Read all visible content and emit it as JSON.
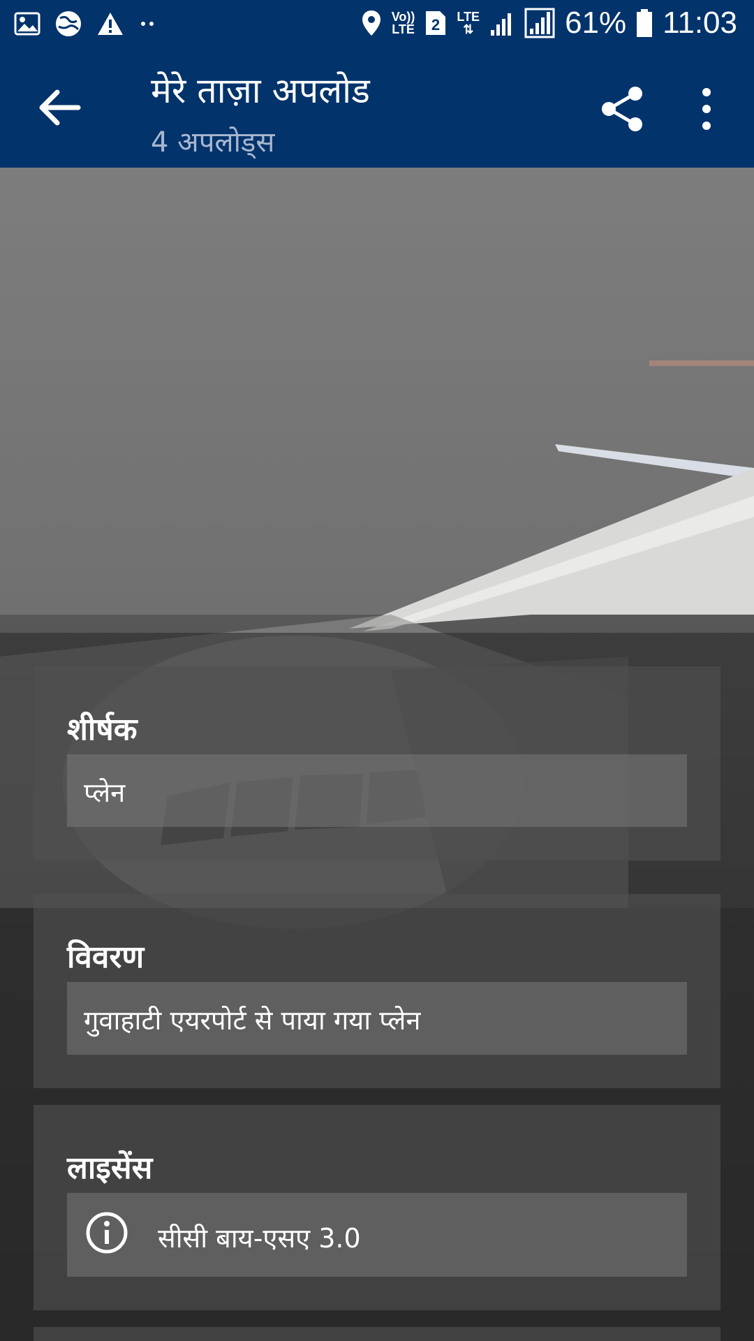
{
  "status_bar": {
    "battery_percent": "61%",
    "time": "11:03",
    "sim_slot": "2",
    "network": "LTE",
    "volte": "Vo)) LTE",
    "icons": [
      "gallery-icon",
      "globe-icon",
      "warning-icon",
      "more-dots-icon",
      "location-icon",
      "volte-icon",
      "sim-2-icon",
      "lte-icon",
      "signal-icon",
      "signal-full-icon",
      "battery-icon"
    ]
  },
  "app_bar": {
    "title": "मेरे ताज़ा अपलोड",
    "subtitle": "4 अपलोड्स",
    "back_icon": "arrow-back-icon",
    "share_icon": "share-icon",
    "more_icon": "more-vert-icon",
    "background": "#03336b"
  },
  "details": {
    "title_section": {
      "label": "शीर्षक",
      "value": "प्लेन"
    },
    "description_section": {
      "label": "विवरण",
      "value": "गुवाहाटी एयरपोर्ट से पाया गया प्लेन"
    },
    "license_section": {
      "label": "लाइसेंस",
      "value": "सीसी बाय-एसए 3.0",
      "icon": "info-icon"
    }
  }
}
